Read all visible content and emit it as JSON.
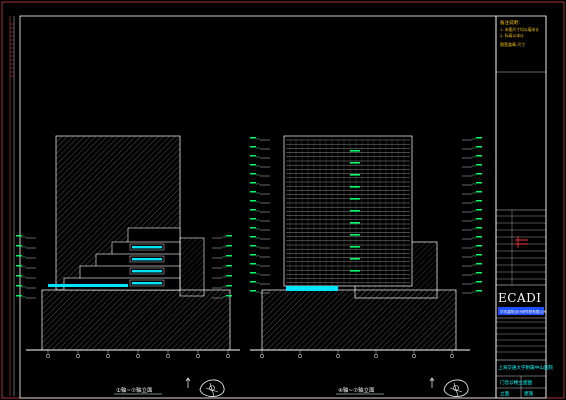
{
  "title_block": {
    "notes_label": "备注说明：",
    "notes_lines": [
      "1. 本图尺寸均以毫米计",
      "2. 标高以米计"
    ],
    "approval_label": "图签盖章 尺寸",
    "company_logo": "ECADI",
    "company_name": "华东建筑设计研究院有限公司",
    "project_name": "上海交通大学附属中山医院",
    "drawing_name": "门急诊楼立面图",
    "sheet_label": "立面",
    "sheet_code": "建施"
  },
  "views": {
    "left_title": "①轴~⑦轴立面",
    "right_title": "④轴~⑦轴立面"
  },
  "colors": {
    "background": "#000000",
    "linework": "#ffffff",
    "annotation": "#00ff66",
    "glazing": "#00e5ff",
    "revision": "#ff3333",
    "hatch": "#8a8a8a"
  },
  "icons": [
    "north-arrow-icon",
    "key-plan-icon",
    "section-marker-icon"
  ]
}
